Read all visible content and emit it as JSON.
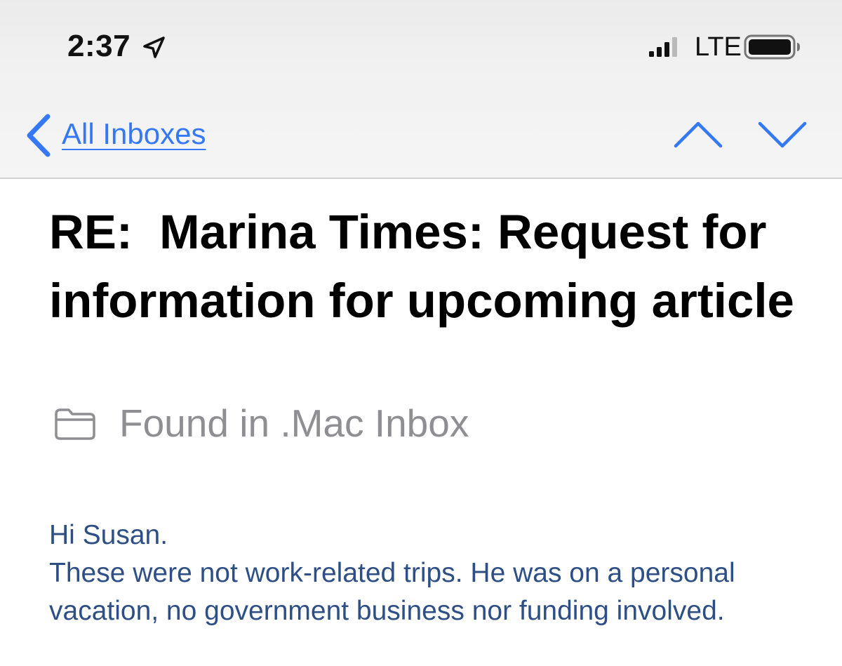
{
  "status_bar": {
    "time": "2:37",
    "location_icon": "location-arrow-icon",
    "signal_icon": "cellular-signal-icon",
    "network": "LTE",
    "battery_icon": "battery-icon"
  },
  "nav": {
    "back_label": "All Inboxes",
    "back_icon": "chevron-left-icon",
    "prev_icon": "chevron-up-icon",
    "next_icon": "chevron-down-icon",
    "accent_color": "#3478f6"
  },
  "message": {
    "subject": "RE:  Marina Times: Request for information for upcoming article",
    "mailbox_icon": "folder-icon",
    "mailbox_label": "Found in .Mac Inbox",
    "body": {
      "greeting": "Hi Susan.",
      "paragraph": "These were not work-related trips. He was on a personal vacation, no government business nor funding involved."
    },
    "body_color": "#2e4f86"
  }
}
